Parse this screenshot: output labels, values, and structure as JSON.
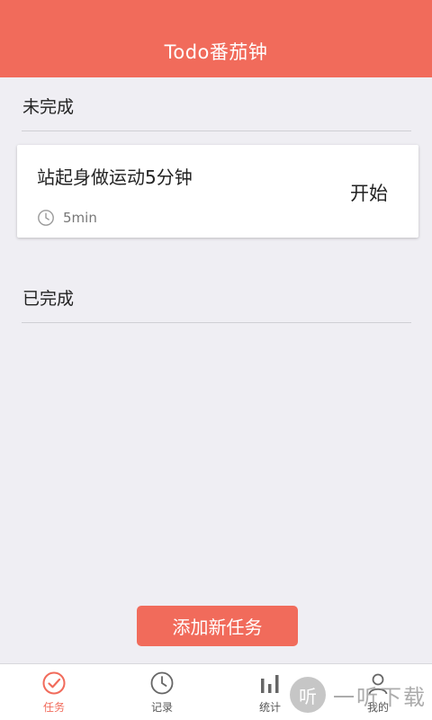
{
  "header": {
    "title": "Todo番茄钟"
  },
  "incomplete": {
    "title": "未完成",
    "tasks": [
      {
        "name": "站起身做运动5分钟",
        "duration": "5min",
        "action": "开始"
      }
    ]
  },
  "complete": {
    "title": "已完成"
  },
  "add_button": {
    "label": "添加新任务"
  },
  "bottom_nav": [
    {
      "label": "任务",
      "icon": "check-circle-icon",
      "active": true
    },
    {
      "label": "记录",
      "icon": "clock-icon",
      "active": false
    },
    {
      "label": "统计",
      "icon": "bar-chart-icon",
      "active": false
    },
    {
      "label": "我的",
      "icon": "user-icon",
      "active": false
    }
  ],
  "watermark": {
    "badge": "听",
    "text": "一听下载"
  },
  "colors": {
    "accent": "#f16b5b",
    "background": "#efeef3"
  }
}
